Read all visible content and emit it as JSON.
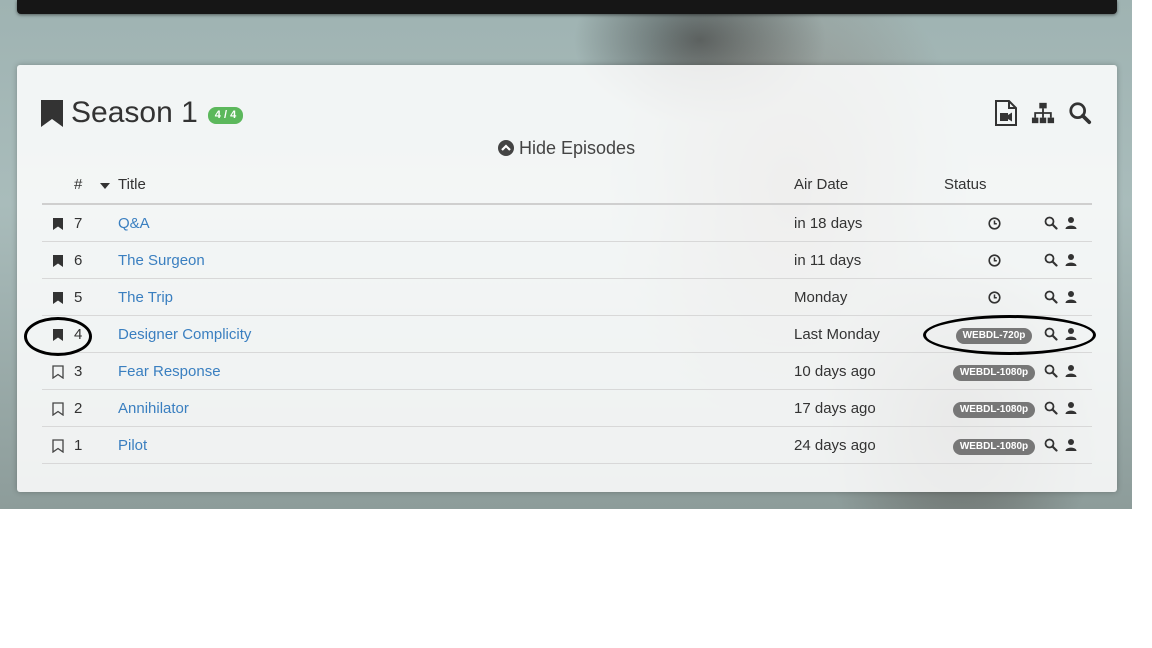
{
  "season": {
    "title": "Season 1",
    "badge": "4 / 4",
    "hide_episodes_label": "Hide Episodes",
    "badge_color": "#5cb85c"
  },
  "header_icons": [
    "file-video-icon",
    "sitemap-icon",
    "search-icon"
  ],
  "table": {
    "columns": {
      "number": "#",
      "title": "Title",
      "air_date": "Air Date",
      "status": "Status"
    },
    "rows": [
      {
        "monitored": true,
        "number": "7",
        "title": "Q&A",
        "air_date": "in 18 days",
        "status": "",
        "status_icon": "clock-icon"
      },
      {
        "monitored": true,
        "number": "6",
        "title": "The Surgeon",
        "air_date": "in 11 days",
        "status": "",
        "status_icon": "clock-icon"
      },
      {
        "monitored": true,
        "number": "5",
        "title": "The Trip",
        "air_date": "Monday",
        "status": "",
        "status_icon": "clock-icon"
      },
      {
        "monitored": true,
        "number": "4",
        "title": "Designer Complicity",
        "air_date": "Last Monday",
        "status": "WEBDL-720p",
        "status_icon": ""
      },
      {
        "monitored": false,
        "number": "3",
        "title": "Fear Response",
        "air_date": "10 days ago",
        "status": "WEBDL-1080p",
        "status_icon": ""
      },
      {
        "monitored": false,
        "number": "2",
        "title": "Annihilator",
        "air_date": "17 days ago",
        "status": "WEBDL-1080p",
        "status_icon": ""
      },
      {
        "monitored": false,
        "number": "1",
        "title": "Pilot",
        "air_date": "24 days ago",
        "status": "WEBDL-1080p",
        "status_icon": ""
      }
    ]
  },
  "colors": {
    "link": "#3a7fc0",
    "quality_badge": "#777777",
    "accent_badge": "#5cb85c"
  }
}
